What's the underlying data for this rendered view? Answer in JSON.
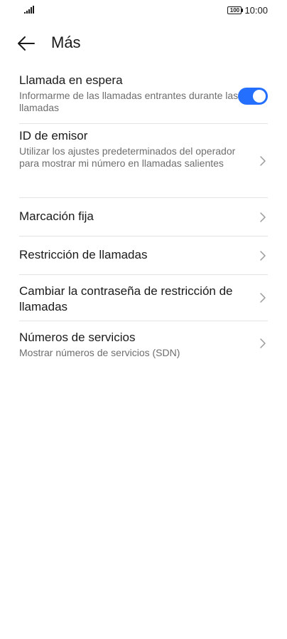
{
  "status_bar": {
    "time": "10:00",
    "battery": "100"
  },
  "header": {
    "title": "Más"
  },
  "items": [
    {
      "title": "Llamada en espera",
      "subtitle": "Informarme de las llamadas entrantes durante las llamadas",
      "control": "toggle",
      "toggle_on": true
    },
    {
      "title": "ID de emisor",
      "subtitle": "Utilizar los ajustes predeterminados del operador para mostrar mi número en llamadas salientes",
      "control": "chevron"
    },
    {
      "title": "Marcación fija",
      "control": "chevron"
    },
    {
      "title": "Restricción de llamadas",
      "control": "chevron"
    },
    {
      "title": "Cambiar la contraseña de restricción de llamadas",
      "control": "chevron"
    },
    {
      "title": "Números de servicios",
      "subtitle": "Mostrar números de servicios (SDN)",
      "control": "chevron"
    }
  ],
  "colors": {
    "accent": "#256fff",
    "text_primary": "#1a1a1a",
    "text_secondary": "#6e6e6e",
    "divider": "#e3e3e3"
  }
}
